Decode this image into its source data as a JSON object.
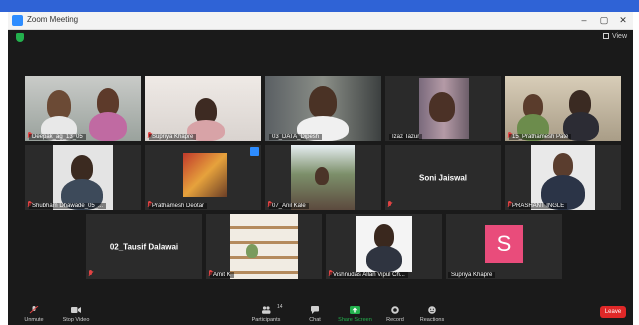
{
  "window": {
    "title": "Zoom Meeting",
    "minimize": "–",
    "maximize": "▢",
    "close": "✕"
  },
  "view_label": "View",
  "tiles": [
    {
      "name": "Deepak_ag_13_05",
      "muted": true
    },
    {
      "name": "Supriya Khapre",
      "muted": true
    },
    {
      "name": "03_DATA_Dipesh",
      "muted": false
    },
    {
      "name": "Izaz Tazur",
      "muted": false
    },
    {
      "name": "15_Prathamesh Pate",
      "muted": true
    },
    {
      "name": "Shubham Dhawade_05_...",
      "muted": true
    },
    {
      "name": "Prathamesh Deotar",
      "muted": true
    },
    {
      "name": "07_Anil Kale",
      "muted": true
    },
    {
      "name": "Soni Jaiswal",
      "muted": true
    },
    {
      "name": "PRASHANT INGLE",
      "muted": true
    },
    {
      "name": "02_Tausif Dalawai",
      "muted": true
    },
    {
      "name": "Amit K",
      "muted": true
    },
    {
      "name": "Vishnudas Allan Vipul Ch...",
      "muted": true
    },
    {
      "name": "Supriya Khapre",
      "muted": false
    }
  ],
  "avatar_letter": "S",
  "toolbar": {
    "unmute": "Unmute",
    "stop_video": "Stop Video",
    "participants": "Participants",
    "participant_count": "14",
    "chat": "Chat",
    "share_screen": "Share Screen",
    "record": "Record",
    "reactions": "Reactions",
    "leave": "Leave"
  },
  "colors": {
    "accent_green": "#23b14d",
    "active_speaker": "#c7e04c",
    "leave_red": "#e02828",
    "zoom_blue": "#2d8cff",
    "avatar_pink": "#e94c7b"
  }
}
